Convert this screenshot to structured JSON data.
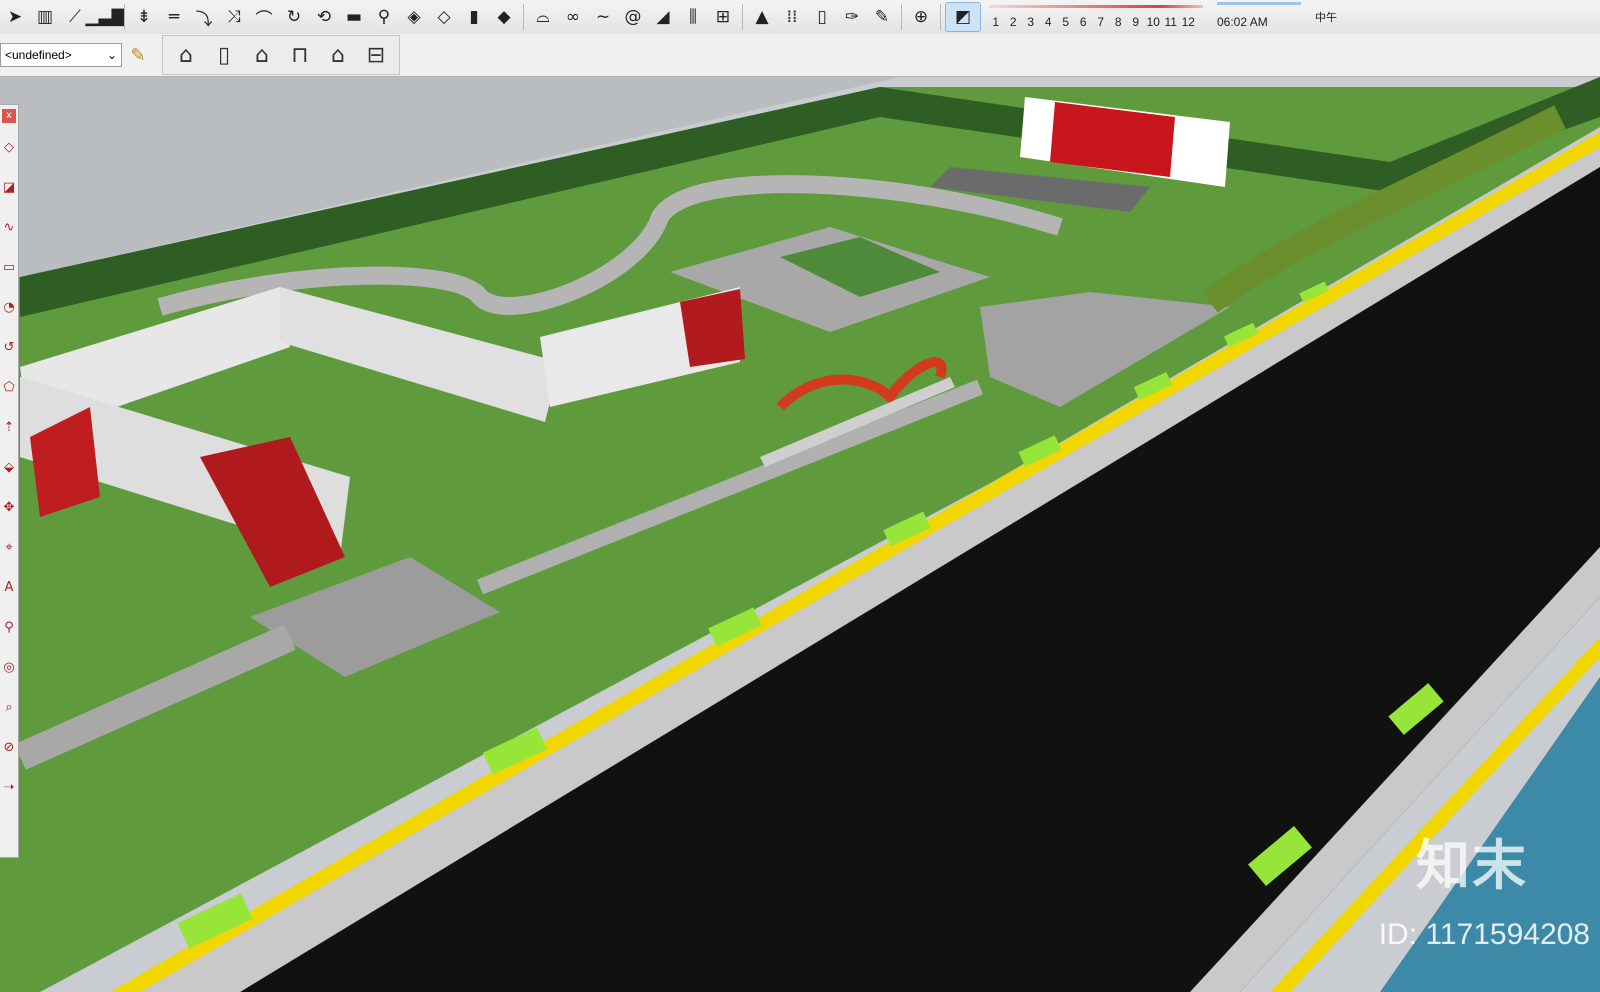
{
  "toolbar": {
    "icons": [
      "select-arrow-icon",
      "grid-icon",
      "stairs-icon",
      "bar-chart-icon",
      "split-icon",
      "line-icon",
      "curve-down-icon",
      "merge-icon",
      "arch-icon",
      "rotate-icon",
      "offset-icon",
      "flat-icon",
      "connect-icon",
      "layer-icon",
      "layer2-icon",
      "box-icon",
      "layer3-icon",
      "arc-icon",
      "chain-icon",
      "wave-icon",
      "spiral-icon",
      "ramp-icon",
      "rail-icon",
      "fence-icon",
      "sail-icon",
      "dots-icon",
      "door-icon",
      "pin-icon",
      "brush-icon",
      "globe-icon",
      "page-icon"
    ],
    "months": [
      "1",
      "2",
      "3",
      "4",
      "5",
      "6",
      "7",
      "8",
      "9",
      "10",
      "11",
      "12"
    ],
    "time": "06:02 AM",
    "noon_label": "中午"
  },
  "toolbar2": {
    "dropdown_value": "<undefined>",
    "house_icons": [
      "house-gable-icon",
      "wall-panel-icon",
      "house-icon",
      "house-flat-icon",
      "house-outline-icon",
      "house-roof-icon"
    ]
  },
  "left_toolbar": {
    "close_label": "x"
  },
  "watermark": {
    "brand": "知末",
    "id_text": "ID: 1171594208"
  }
}
